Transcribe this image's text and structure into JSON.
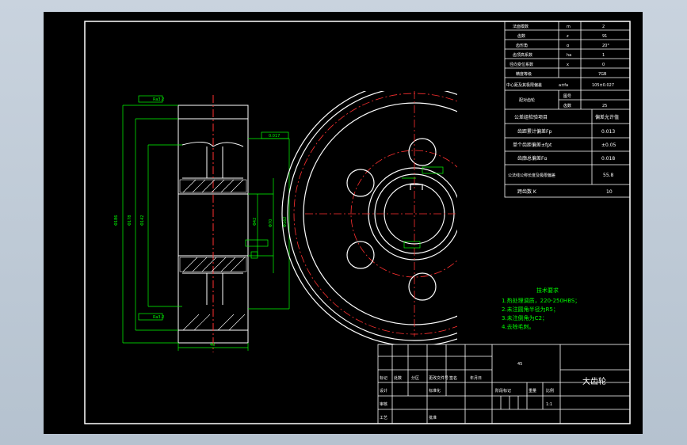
{
  "param_table": {
    "rows": [
      {
        "label": "法面模数",
        "sym": "m",
        "val": "2"
      },
      {
        "label": "齿数",
        "sym": "z",
        "val": "91"
      },
      {
        "label": "齿形角",
        "sym": "α",
        "val": "20°"
      },
      {
        "label": "齿顶高系数",
        "sym": "ha",
        "val": "1"
      },
      {
        "label": "径向变位系数",
        "sym": "x",
        "val": "0"
      },
      {
        "label": "精度等级",
        "sym": "",
        "val": "7GB"
      },
      {
        "label": "中心距及其极限偏差",
        "sym": "a±fa",
        "val": "105±0.027"
      }
    ],
    "mating_label": "配对齿轮",
    "mating_sub": [
      "图号",
      "齿数"
    ],
    "mating_val": "25",
    "check_header": [
      "公差组检验项目",
      "偏差允许值"
    ],
    "check_rows": [
      {
        "label": "齿距累计偏差Fp",
        "val": "0.013"
      },
      {
        "label": "单个齿距偏差±fpt",
        "val": "±0.05"
      },
      {
        "label": "齿廓总偏差Fα",
        "val": "0.018"
      },
      {
        "label": "公法线公称长度及极限偏差",
        "val": "55.8"
      }
    ],
    "span_label": "跨齿数 K",
    "span_val": "10"
  },
  "tech_requirements": {
    "title": "技术要求",
    "items": [
      "1.热处理调质，220-250HBS；",
      "2.未注圆角半径为R5；",
      "3.未注倒角为C2；",
      "4.去除毛刺。"
    ]
  },
  "title_block": {
    "part_name": "大齿轮",
    "material": "45",
    "scale": "1:1",
    "cells": [
      "标记",
      "处数",
      "分区",
      "更改文件号",
      "签名",
      "年月日",
      "设计",
      "标准化",
      "阶段标记",
      "重量",
      "比例",
      "审核",
      "工艺",
      "批准"
    ]
  },
  "dims": {
    "left_width": "40",
    "bore": "Φ42",
    "hub": "Φ70",
    "root": "Φ178",
    "tip": "Φ186",
    "ra": "Ra3.2",
    "tol": "0.017"
  }
}
